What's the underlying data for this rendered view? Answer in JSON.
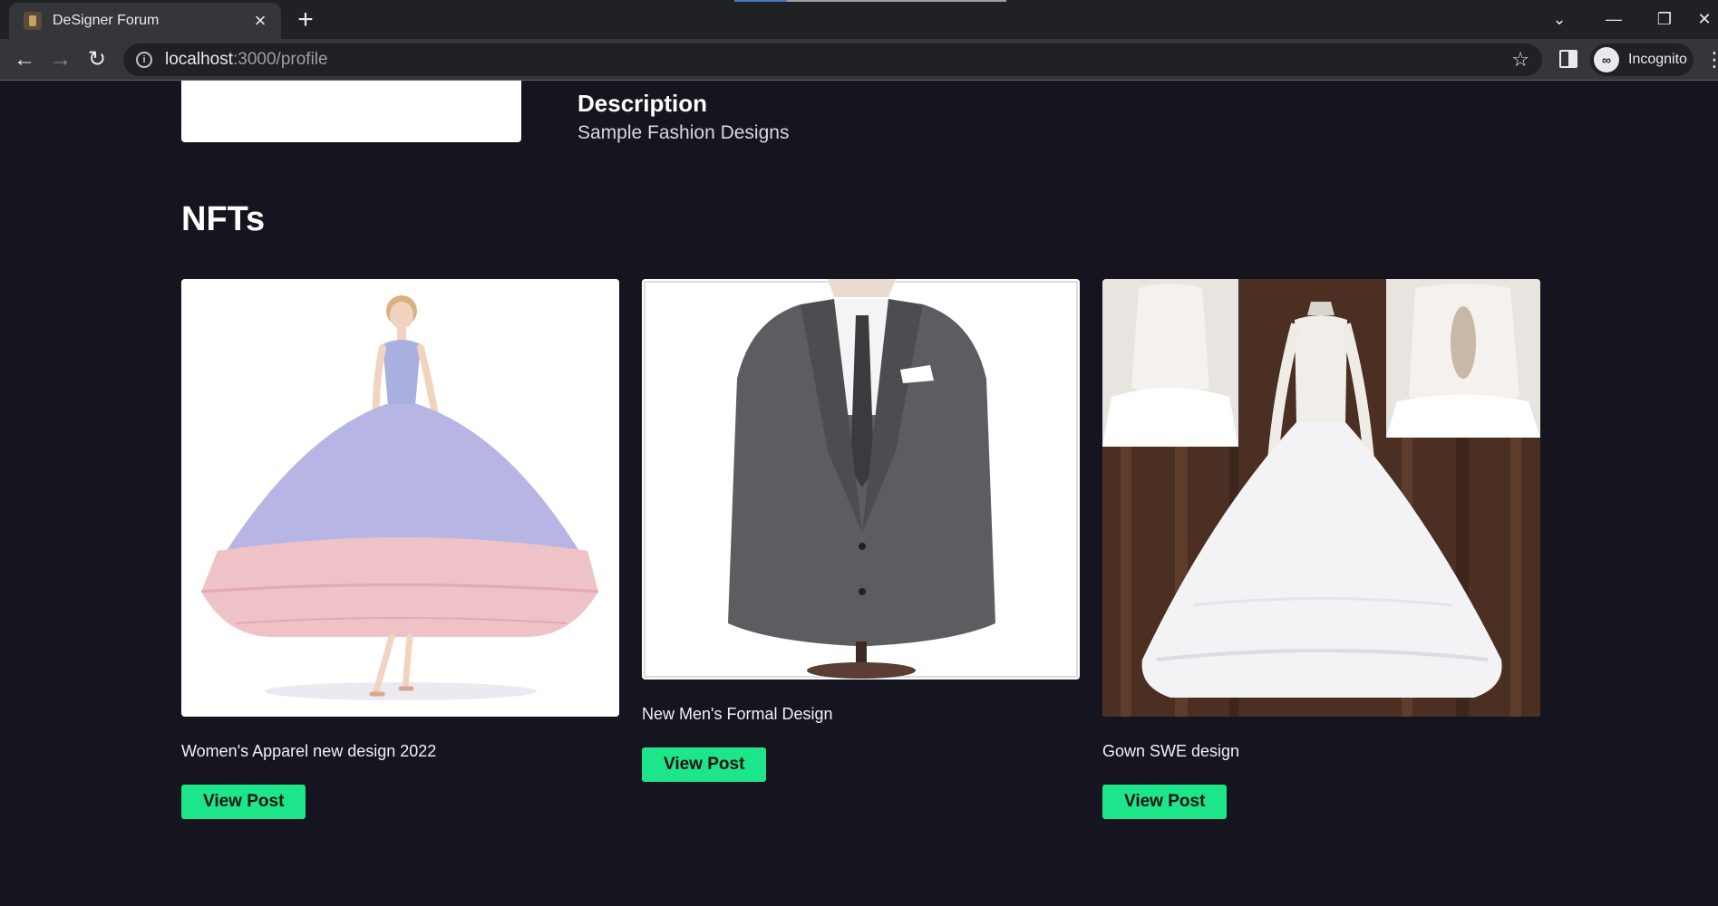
{
  "browser": {
    "tab_title": "DeSigner Forum",
    "url_host": "localhost",
    "url_path": ":3000/profile",
    "profile_label": "Incognito"
  },
  "profile": {
    "description_heading": "Description",
    "description_text": "Sample Fashion Designs"
  },
  "nfts": {
    "section_title": "NFTs",
    "items": [
      {
        "title": "Women's Apparel new design 2022",
        "button_label": "View Post"
      },
      {
        "title": "New Men's Formal Design",
        "button_label": "View Post"
      },
      {
        "title": "Gown SWE design",
        "button_label": "View Post"
      }
    ]
  },
  "colors": {
    "page_bg": "#16151f",
    "button_bg": "#1de589"
  }
}
